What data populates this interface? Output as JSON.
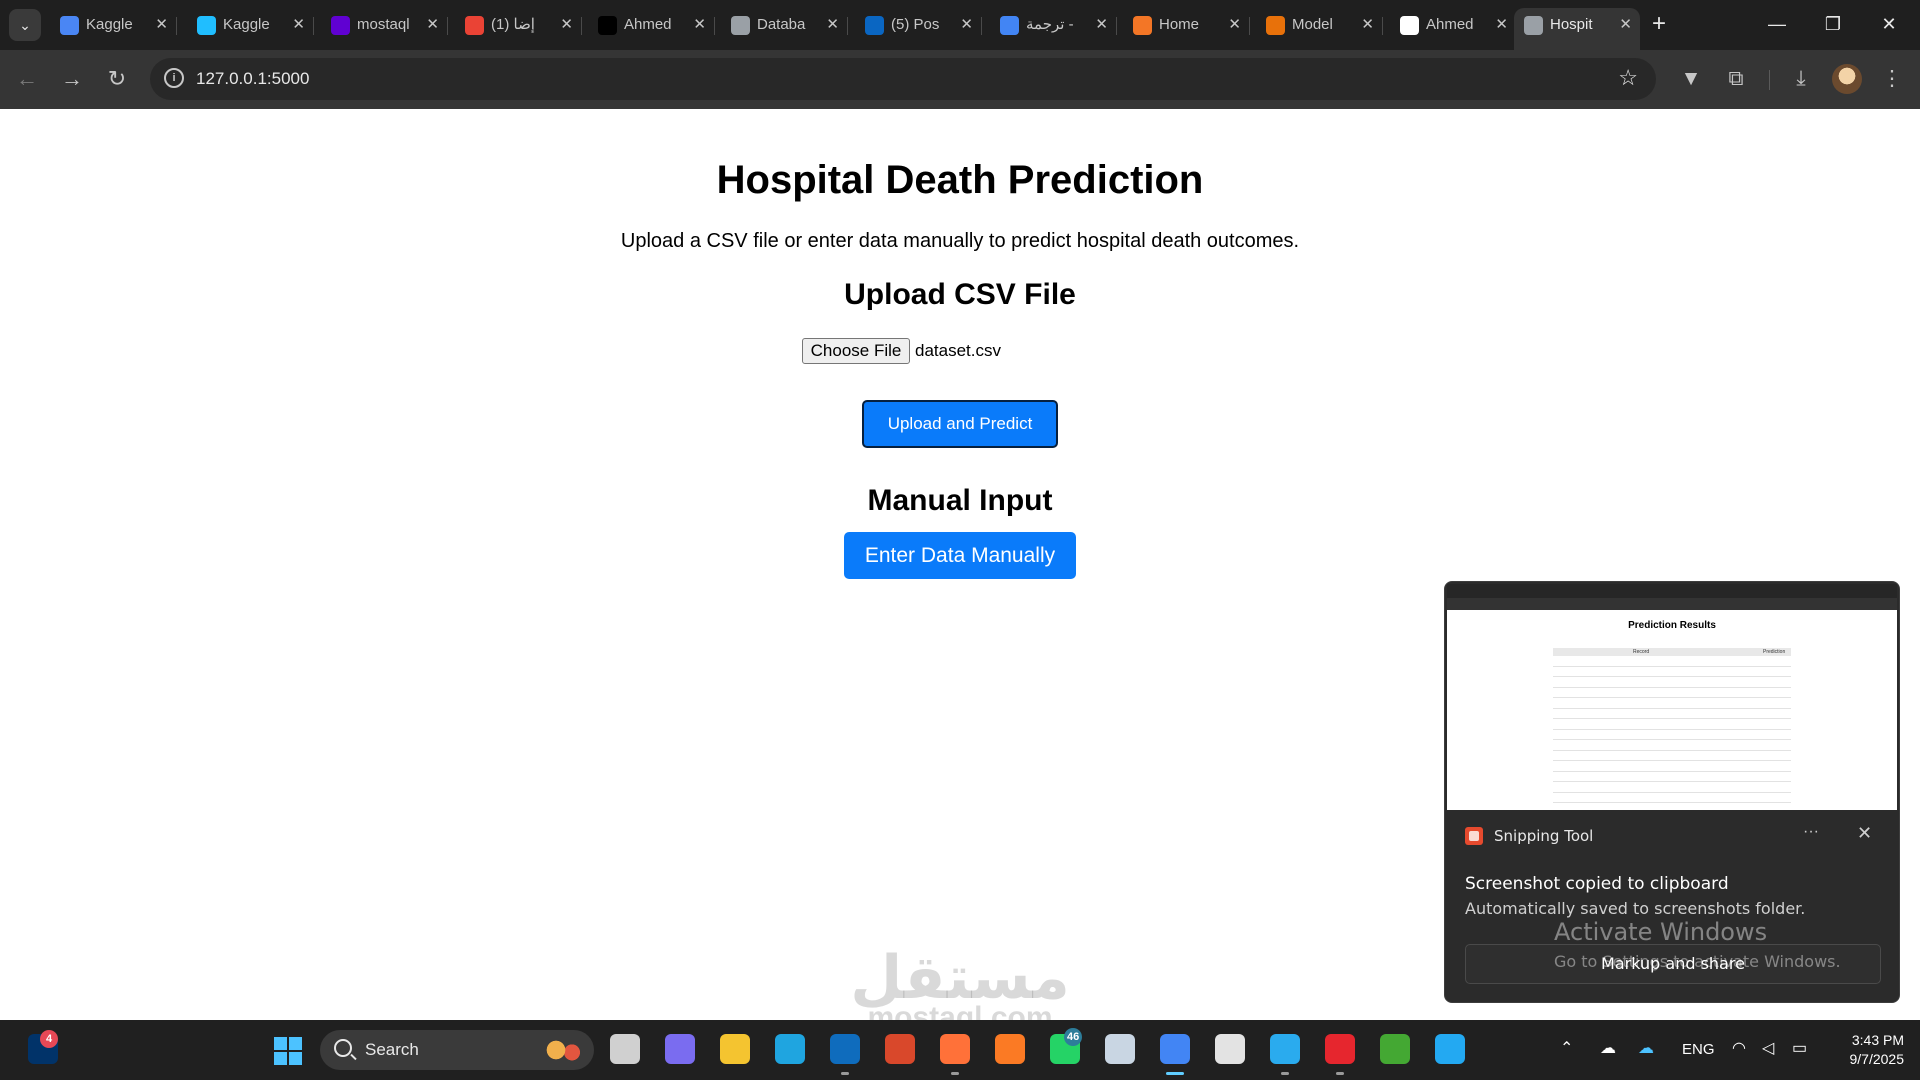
{
  "browser": {
    "tabs": [
      {
        "title": "Kaggle",
        "icon": "docs-icon",
        "color": "#4a86f4"
      },
      {
        "title": "Kaggle",
        "icon": "kaggle-icon",
        "color": "#20beff"
      },
      {
        "title": "mostaql",
        "icon": "yahoo-icon",
        "color": "#6001d2"
      },
      {
        "title": "(1) إضا",
        "icon": "chrome-icon",
        "color": "#ea4335"
      },
      {
        "title": "Ahmed",
        "icon": "upwork-icon",
        "color": "#000000"
      },
      {
        "title": "Databa",
        "icon": "database-icon",
        "color": "#9aa0a6"
      },
      {
        "title": "(5) Pos",
        "icon": "linkedin-icon",
        "color": "#0a66c2"
      },
      {
        "title": "ترجمة -",
        "icon": "translate-icon",
        "color": "#4285f4"
      },
      {
        "title": "Home",
        "icon": "jupyter-icon",
        "color": "#f37626"
      },
      {
        "title": "Model",
        "icon": "book-icon",
        "color": "#e8710a"
      },
      {
        "title": "Ahmed",
        "icon": "github-icon",
        "color": "#ffffff"
      },
      {
        "title": "Hospit",
        "icon": "globe-icon",
        "color": "#9aa0a6",
        "active": true
      }
    ],
    "url": "127.0.0.1:5000"
  },
  "page": {
    "title": "Hospital Death Prediction",
    "subtitle": "Upload a CSV file or enter data manually to predict hospital death outcomes.",
    "upload_heading": "Upload CSV File",
    "choose_file_label": "Choose File",
    "file_name": "dataset.csv",
    "upload_button": "Upload and Predict",
    "manual_heading": "Manual Input",
    "manual_button": "Enter Data Manually",
    "accent_color": "#0a7bfa"
  },
  "watermark": {
    "arabic": "مستقل",
    "latin": "mostaql.com"
  },
  "notification": {
    "app": "Snipping Tool",
    "message": "Screenshot copied to clipboard",
    "detail": "Automatically saved to screenshots folder.",
    "action": "Markup and share",
    "preview": {
      "title": "Prediction Results",
      "columns": [
        "Record",
        "Prediction"
      ],
      "row_count": 14
    }
  },
  "activation": {
    "title": "Activate Windows",
    "detail": "Go to Settings to activate Windows."
  },
  "taskbar": {
    "search_placeholder": "Search",
    "widget_badge": "4",
    "whatsapp_badge": "46",
    "language": "ENG",
    "time": "3:43 PM",
    "date": "9/7/2025",
    "pinned": [
      {
        "name": "task-view-icon",
        "color": "#d0d0d0"
      },
      {
        "name": "copilot-icon",
        "color": "#7a6cf0"
      },
      {
        "name": "file-explorer-icon",
        "color": "#f4c430"
      },
      {
        "name": "edge-icon",
        "color": "#1fa5e0"
      },
      {
        "name": "outlook-icon",
        "color": "#0f6cbd"
      },
      {
        "name": "m365-icon",
        "color": "#d9482b"
      },
      {
        "name": "firefox-icon",
        "color": "#ff7139"
      },
      {
        "name": "xampp-icon",
        "color": "#fb7a24"
      },
      {
        "name": "whatsapp-icon",
        "color": "#25d366"
      },
      {
        "name": "virtualbox-icon",
        "color": "#c9d6e3"
      },
      {
        "name": "chrome-icon",
        "color": "#4285f4"
      },
      {
        "name": "store-icon",
        "color": "#e3e3e3"
      },
      {
        "name": "telegram-icon",
        "color": "#2aabee"
      },
      {
        "name": "wps-icon",
        "color": "#e6262e"
      },
      {
        "name": "anaconda-icon",
        "color": "#44a833"
      },
      {
        "name": "vscode-icon",
        "color": "#23a9f2"
      }
    ]
  }
}
